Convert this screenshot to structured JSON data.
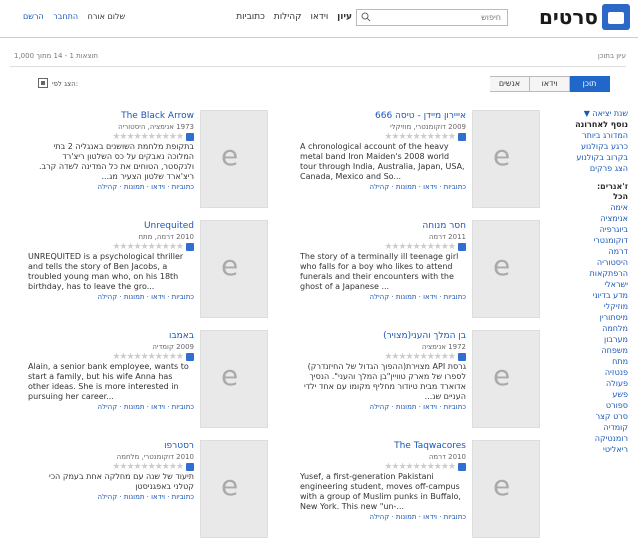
{
  "brand": {
    "name": "סרטים"
  },
  "search": {
    "placeholder": "חיפוש"
  },
  "nav": [
    "עיון",
    "וידאו",
    "קהילות",
    "כתוביות"
  ],
  "user": {
    "greeting": "שלום אורח",
    "login": "התחבר",
    "signup": "הרשם"
  },
  "strip": {
    "right": "עיון בתוכן",
    "left": "תוצאות 1 - 14 מתוך 1,000"
  },
  "tabs": [
    "תוכן",
    "וידאו",
    "אנשים"
  ],
  "view": {
    "label": "הצג לפי:"
  },
  "sidebar": {
    "sortHeader": "שנת יציאה ▼",
    "sort": [
      "נוסף לאחרונה",
      "המדורג ביותר",
      "כרגע בקולנוע",
      "בקרוב בקולנוע",
      "הצג פרקים"
    ],
    "genresHeader": "ז'אנרים:",
    "genres": [
      "הכל",
      "אימה",
      "אנימציה",
      "ביוגרפיה",
      "דוקומנטרי",
      "דרמה",
      "היסטוריה",
      "הרפתקאות",
      "ישראלי",
      "מדע בדיוני",
      "מוזיקלי",
      "מיסתורין",
      "מלחמה",
      "מערבון",
      "משפחה",
      "מתח",
      "פנטזיה",
      "פעולה",
      "פשע",
      "ספורט",
      "סרט קצר",
      "קומדיה",
      "רומנטיקה",
      "ריאליטי"
    ]
  },
  "cards": [
    {
      "title": "אייירון מיידן - טיסה 666",
      "meta": "2009 דוקומנטרי, מוזיקלי",
      "desc": "A chronological account of the heavy metal band Iron Maiden's 2008 world tour through India, Australia, Japan, USA, Canada, Mexico and So...",
      "ltr": true,
      "links": "כתוביות · וידאו · תמונות · קהילה"
    },
    {
      "title": "The Black Arrow",
      "meta": "1973 אנימציה, היסטוריה",
      "desc": "בתקופת מלחמת השושנים באנגליה 2 בתי המלוכה נאבקים על כס השלטון ריצ'רד ולנקסטר, הטוחים את כל המדינה לשדה קרב. ריצ'ארד שלטון הצעיר מג...",
      "ltr": false,
      "links": "כתוביות · וידאו · תמונות · קהילה"
    },
    {
      "title": "חסר מנוחה",
      "meta": "2011 דרמה",
      "desc": "The story of a terminally ill teenage girl who falls for a boy who likes to attend funerals and their encounters with the ghost of a Japanese ...",
      "ltr": true,
      "links": "כתוביות · וידאו · תמונות · קהילה"
    },
    {
      "title": "Unrequited",
      "meta": "2010 דרמה, מתח",
      "desc": "UNREQUITED is a psychological thriller and tells the story of Ben Jacobs, a troubled young man who, on his 18th birthday, has to leave the gro...",
      "ltr": true,
      "links": "כתוביות · וידאו · תמונות · קהילה"
    },
    {
      "title": "בן המלך והעני(מצויר)",
      "meta": "1972 אנימציה",
      "desc": "גרסת API מצוירת(ההפוך הגדול של החיזנדרק) לספרו של מארק טוויין\"בן המלך והעני\". הנסיך אדוארד מבית טיודור מחליף מקומו עם אחד ילדי העניים שנ...",
      "ltr": false,
      "links": "כתוביות · וידאו · תמונות · קהילה"
    },
    {
      "title": "באמבו",
      "meta": "2009 קומדיה",
      "desc": "Alain, a senior bank employee, wants to start a family, but his wife Anna has other ideas. She is more interested in pursuing her career...",
      "ltr": true,
      "links": "כתוביות · וידאו · תמונות · קהילה"
    },
    {
      "title": "The Taqwacores",
      "meta": "2010 דרמה",
      "desc": "Yusef, a first-generation Pakistani engineering student, moves off-campus with a group of Muslim punks in Buffalo, New York. This new \"un-...",
      "ltr": true,
      "links": "כתוביות · וידאו · תמונות · קהילה"
    },
    {
      "title": "רסטרפו",
      "meta": "2010 דוקומנטרי, מלחמה",
      "desc": "תיעוד של שנה עם מחלקה אחת בעמק הכי קטלני באפגניסטן",
      "ltr": false,
      "links": "כתוביות · וידאו · תמונות · קהילה"
    }
  ]
}
